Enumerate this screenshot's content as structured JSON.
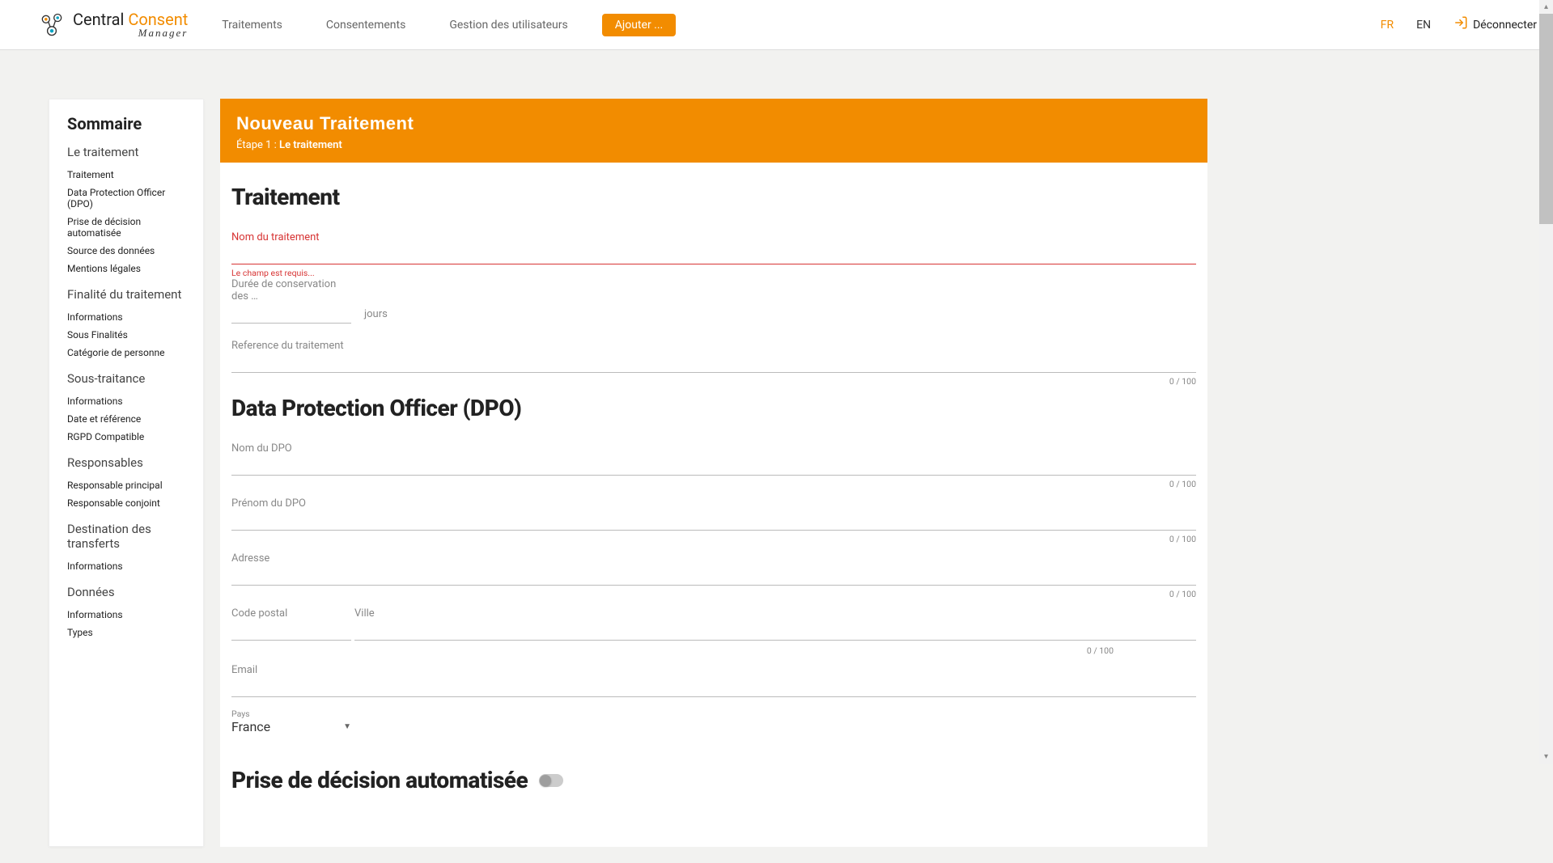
{
  "brand": {
    "name1": "Central ",
    "name2": "Consent",
    "sub": "Manager"
  },
  "nav": {
    "traitements": "Traitements",
    "consentements": "Consentements",
    "gestion": "Gestion des utilisateurs",
    "ajouter": "Ajouter ..."
  },
  "header": {
    "fr": "FR",
    "en": "EN",
    "logout": "Déconnecter"
  },
  "sidebar": {
    "title": "Sommaire",
    "sections": [
      {
        "head": "Le traitement",
        "items": [
          "Traitement",
          "Data Protection Officer (DPO)",
          "Prise de décision automatisée",
          "Source des données",
          "Mentions légales"
        ]
      },
      {
        "head": "Finalité du traitement",
        "items": [
          "Informations",
          "Sous Finalités",
          "Catégorie de personne"
        ]
      },
      {
        "head": "Sous-traitance",
        "items": [
          "Informations",
          "Date et référence",
          "RGPD Compatible"
        ]
      },
      {
        "head": "Responsables",
        "items": [
          "Responsable principal",
          "Responsable conjoint"
        ]
      },
      {
        "head": "Destination des transferts",
        "items": [
          "Informations"
        ]
      },
      {
        "head": "Données",
        "items": [
          "Informations",
          "Types"
        ]
      }
    ]
  },
  "banner": {
    "title": "Nouveau Traitement",
    "step_prefix": "Étape 1 : ",
    "step_name": "Le traitement"
  },
  "form": {
    "section_traitement": "Traitement",
    "nom_traitement_label": "Nom du traitement",
    "nom_traitement_error": "Le champ est requis...",
    "duree_label": "Durée de conservation des …",
    "duree_unit": "jours",
    "reference_label": "Reference du traitement",
    "counter_100": "0 / 100",
    "section_dpo": "Data Protection Officer (DPO)",
    "dpo_nom": "Nom du DPO",
    "dpo_prenom": "Prénom du DPO",
    "dpo_adresse": "Adresse",
    "dpo_cp": "Code postal",
    "dpo_ville": "Ville",
    "dpo_email": "Email",
    "pays_label": "Pays",
    "pays_value": "France",
    "section_prise": "Prise de décision automatisée"
  }
}
